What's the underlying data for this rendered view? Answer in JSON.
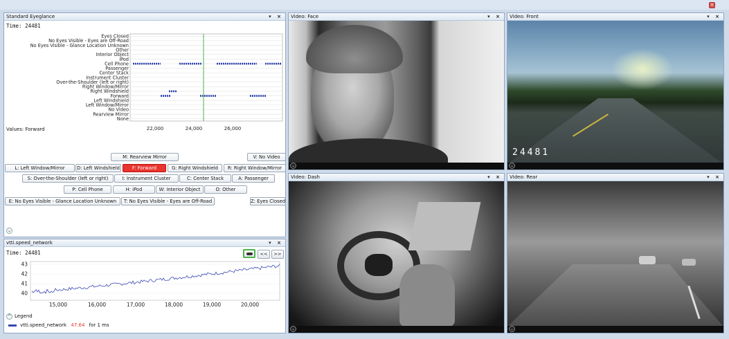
{
  "app": {
    "close_glyph": "×"
  },
  "eyeglance": {
    "title": "Standard Eyeglance",
    "controls": "▾ ×",
    "time_text": "Time: 24481",
    "categories": [
      "Eyes Closed",
      "No Eyes Visible - Eyes are Off-Road",
      "No Eyes Visible - Glance Location Unknown",
      "Other",
      "Interior Object",
      "iPod",
      "Cell Phone",
      "Passenger",
      "Center Stack",
      "Instrument Cluster",
      "Over-the-Shoulder (left or right)",
      "Right Window/Mirror",
      "Right Windshield",
      "Forward",
      "Left Windshield",
      "Left Window/Mirror",
      "No Video",
      "Rearview Mirror",
      "None"
    ],
    "x_ticks": [
      "22,000",
      "24,000",
      "26,000"
    ],
    "values_text": "Values: Forward",
    "buttons": {
      "rearview": "M: Rearview Mirror",
      "novideo": "V: No Video",
      "left_window": "L: Left Window/Mirror",
      "left_windshield": "D: Left Windshield",
      "forward": "F: Forward",
      "right_windshield": "G: Right Windshield",
      "right_window": "R: Right Window/Mirror",
      "over_shoulder": "S: Over-the-Shoulder (left or right)",
      "instrument": "I: Instrument Cluster",
      "center_stack": "C: Center Stack",
      "passenger": "A: Passenger",
      "cell_phone": "P: Cell Phone",
      "ipod": "H: iPod",
      "interior_object": "W: Interior Object",
      "other": "O: Other",
      "glance_unknown": "E: No Eyes Visible - Glance Location Unknown",
      "eyes_offroad": "T: No Eyes Visible - Eyes are Off-Road",
      "eyes_closed": "Z: Eyes Closed"
    },
    "expander_glyph": "⌄"
  },
  "speed": {
    "title": "vtti.speed_network",
    "controls": "▾ ×",
    "time_text": "Time: 24481",
    "y_ticks": [
      "43",
      "42",
      "41",
      "40"
    ],
    "x_ticks": [
      "15,000",
      "16,000",
      "17,000",
      "18,000",
      "19,000",
      "20,000"
    ],
    "prev_label": "<<",
    "next_label": ">>",
    "legend_title": "Legend",
    "legend_series": "vtti.speed_network",
    "legend_value": "47.64",
    "legend_duration": "for 1 ms",
    "series_color": "#3a48b0",
    "value_color": "#e8352f",
    "expander_glyph": "^"
  },
  "videos": {
    "face": {
      "title": "Video: Face",
      "controls": "▾ ×"
    },
    "front": {
      "title": "Video: Front",
      "controls": "▾ ×",
      "counter": "24481"
    },
    "dash": {
      "title": "Video: Dash",
      "controls": "▾ ×"
    },
    "rear": {
      "title": "Video: Rear",
      "controls": "▾ ×"
    }
  }
}
